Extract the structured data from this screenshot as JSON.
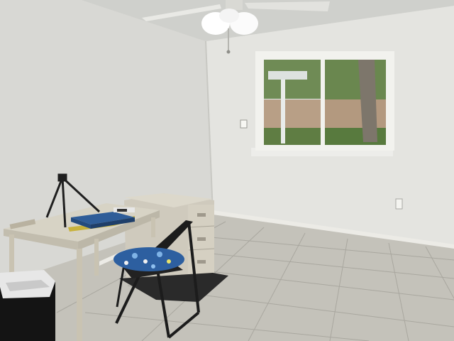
{
  "scene": {
    "kind": "room-photo",
    "colors": {
      "wall_left": "#d8d8d4",
      "wall_right": "#e4e4e0",
      "ceiling": "#cfd0cc",
      "floor": "#c4c2ba",
      "floor_grout": "#a9a79f",
      "baseboard": "#ecebe6",
      "window_frame": "#f2f2ee",
      "foliage": "#5f7d43",
      "fence": "#b89f86",
      "sky": "#dfe7e6",
      "desk_top": "#d7d3c5",
      "desk_leg": "#c9c3b2",
      "cabinet": "#d5d0c2",
      "chair_frame": "#1c1c1c",
      "cushion": "#2d5fa0",
      "binder": "#2f5d98",
      "trash_can": "#141414",
      "trash_bag": "#e7e7e7",
      "mat": "#2a2a2a"
    },
    "objects": [
      "ceiling-fan",
      "window",
      "thermostat",
      "wall-outlet",
      "desk",
      "file-cabinet",
      "folding-chair",
      "blue-cushion",
      "tripod-stand",
      "blue-binder",
      "trash-can",
      "floor-mat",
      "tile-floor"
    ]
  }
}
